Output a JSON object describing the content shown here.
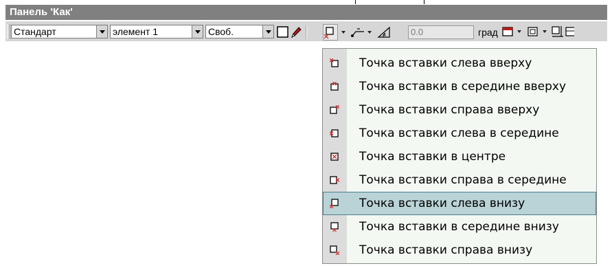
{
  "panel": {
    "title": "Панель 'Как'"
  },
  "toolbar": {
    "style_combo": "Стандарт",
    "element_combo": "элемент 1",
    "mode_combo": "Своб.",
    "angle_value": "0.0",
    "angle_unit": "град"
  },
  "menu": {
    "selected_index": 6,
    "items": [
      {
        "label": "Точка вставки слева вверху",
        "icon": "insert-point-top-left-icon"
      },
      {
        "label": "Точка вставки в середине вверху",
        "icon": "insert-point-top-center-icon"
      },
      {
        "label": "Точка вставки справа вверху",
        "icon": "insert-point-top-right-icon"
      },
      {
        "label": "Точка вставки слева в середине",
        "icon": "insert-point-middle-left-icon"
      },
      {
        "label": "Точка вставки в центре",
        "icon": "insert-point-center-icon"
      },
      {
        "label": "Точка вставки справа в середине",
        "icon": "insert-point-middle-right-icon"
      },
      {
        "label": "Точка вставки слева внизу",
        "icon": "insert-point-bottom-left-icon"
      },
      {
        "label": "Точка вставки в середине внизу",
        "icon": "insert-point-bottom-center-icon"
      },
      {
        "label": "Точка вставки справа внизу",
        "icon": "insert-point-bottom-right-icon"
      }
    ]
  },
  "colors": {
    "title_bar": "#808080",
    "toolbar": "#d6d6d6",
    "menu_bg": "#f4f8f3",
    "selection": "#b9d3d6",
    "marker": "#d23030"
  }
}
